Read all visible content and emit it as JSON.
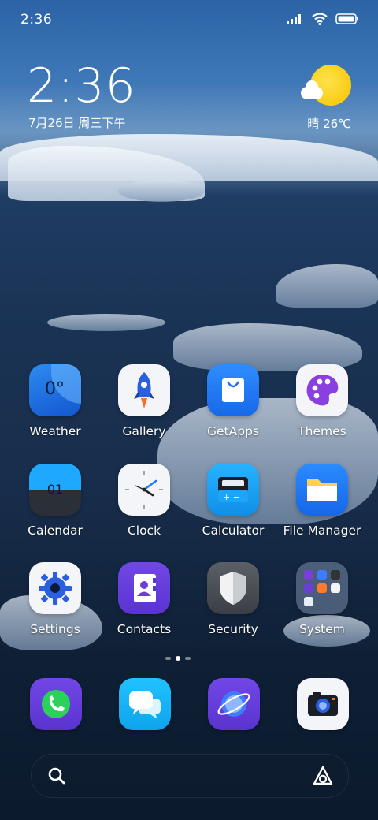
{
  "status_bar": {
    "time": "2:36",
    "icons": [
      "signal-icon",
      "wifi-icon",
      "battery-icon"
    ]
  },
  "clock_widget": {
    "time": "2:36",
    "date": "7月26日 周三下午"
  },
  "weather_widget": {
    "condition_icon": "sunny-partly-cloudy-icon",
    "text": "晴 26℃"
  },
  "apps": [
    {
      "label": "Weather",
      "icon": "weather-icon",
      "inner": "0°"
    },
    {
      "label": "Gallery",
      "icon": "rocket-icon"
    },
    {
      "label": "GetApps",
      "icon": "shopping-bag-icon"
    },
    {
      "label": "Themes",
      "icon": "palette-icon"
    },
    {
      "label": "Calendar",
      "icon": "calendar-icon",
      "inner": "01"
    },
    {
      "label": "Clock",
      "icon": "clock-icon"
    },
    {
      "label": "Calculator",
      "icon": "calculator-icon"
    },
    {
      "label": "File Manager",
      "icon": "folder-icon"
    },
    {
      "label": "Settings",
      "icon": "gear-icon"
    },
    {
      "label": "Contacts",
      "icon": "contacts-book-icon"
    },
    {
      "label": "Security",
      "icon": "shield-icon"
    },
    {
      "label": "System",
      "icon": "folder-grid-icon"
    }
  ],
  "page_indicator": {
    "count": 3,
    "active_index": 1
  },
  "dock": [
    {
      "name": "phone",
      "icon": "phone-icon"
    },
    {
      "name": "messages",
      "icon": "messages-icon"
    },
    {
      "name": "browser",
      "icon": "browser-icon"
    },
    {
      "name": "camera",
      "icon": "camera-icon"
    }
  ],
  "search_bar": {
    "left_icon": "search-icon",
    "right_icon": "assistant-icon"
  },
  "colors": {
    "weather_blue": "#1565d8",
    "themes_purple": "#7b3fd9",
    "contacts_purple": "#6b3fd6",
    "phone_green": "#2bd25a",
    "messages_cyan": "#1bb7f0",
    "browser_blue": "#3d7bff",
    "sun_yellow": "#f5c300"
  }
}
